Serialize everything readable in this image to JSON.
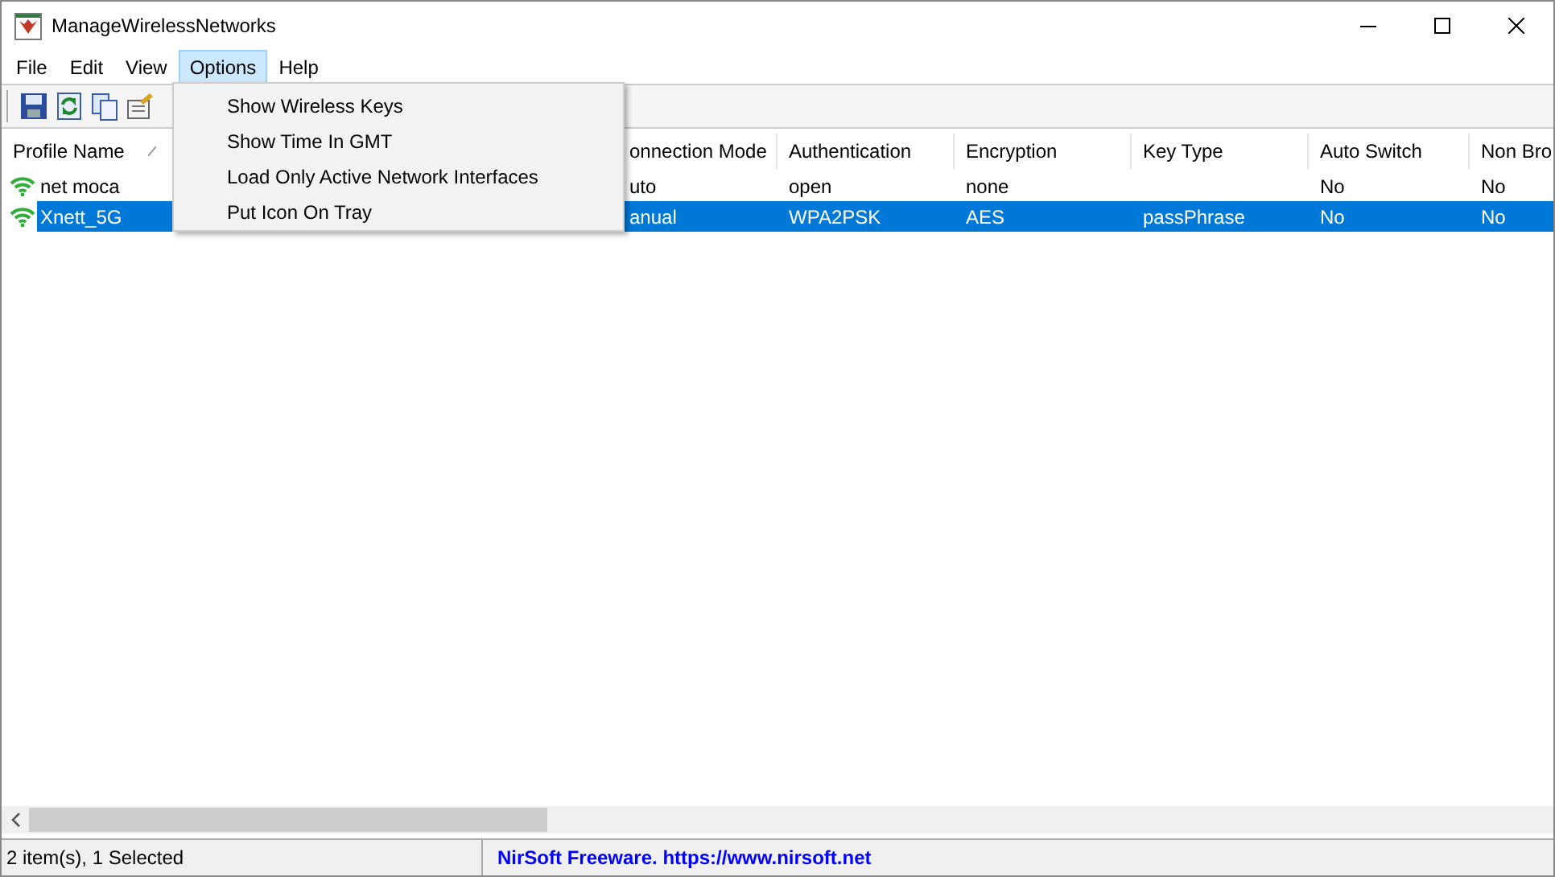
{
  "window": {
    "title": "ManageWirelessNetworks"
  },
  "menu_bar": [
    {
      "label": "File",
      "selected": false
    },
    {
      "label": "Edit",
      "selected": false
    },
    {
      "label": "View",
      "selected": false
    },
    {
      "label": "Options",
      "selected": true
    },
    {
      "label": "Help",
      "selected": false
    }
  ],
  "open_menu": {
    "items": [
      "Show Wireless Keys",
      "Show Time In GMT",
      "Load Only Active Network Interfaces",
      "Put Icon On Tray"
    ]
  },
  "table": {
    "columns": [
      {
        "label": "Profile Name",
        "sorted": true
      },
      {
        "label": "onnection Mode"
      },
      {
        "label": "Authentication"
      },
      {
        "label": "Encryption"
      },
      {
        "label": "Key Type"
      },
      {
        "label": "Auto Switch"
      },
      {
        "label": "Non Bro"
      }
    ],
    "rows": [
      {
        "selected": false,
        "cells": [
          "net moca",
          "uto",
          "open",
          "none",
          "",
          "No",
          "No"
        ]
      },
      {
        "selected": true,
        "cells": [
          "Xnett_5G",
          "anual",
          "WPA2PSK",
          "AES",
          "passPhrase",
          "No",
          "No"
        ]
      }
    ]
  },
  "status_bar": {
    "summary": "2 item(s), 1 Selected",
    "link": "NirSoft Freeware. https://www.nirsoft.net"
  }
}
